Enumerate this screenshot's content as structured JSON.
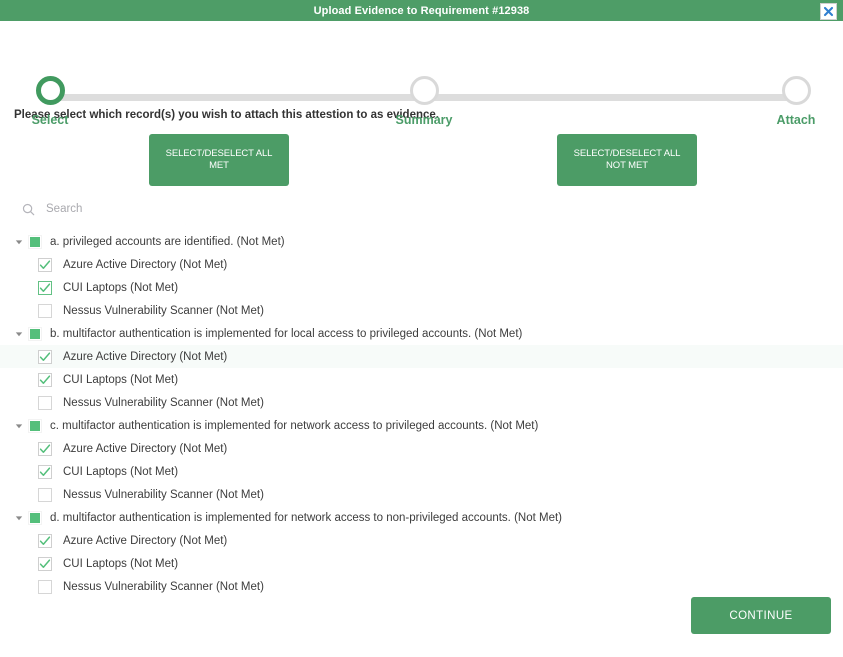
{
  "titlebar": {
    "title": "Upload Evidence to Requirement #12938",
    "close_icon": "close-icon",
    "background": "#4e9d67"
  },
  "stepper": {
    "steps": [
      {
        "label": "Select",
        "state": "active"
      },
      {
        "label": "Summary",
        "state": "inactive"
      },
      {
        "label": "Attach",
        "state": "inactive"
      }
    ],
    "active_color": "#419a5f",
    "inactive_color": "#d9d9d9",
    "label_color": "#4b9c68"
  },
  "instruction": "Please select which record(s) you wish to attach this attestion to as evidence.",
  "actions": {
    "select_all_met_line1": "SELECT/DESELECT ALL",
    "select_all_met_line2": "MET",
    "select_all_notmet_line1": "SELECT/DESELECT ALL",
    "select_all_notmet_line2": "NOT MET",
    "button_color": "#4c9c66"
  },
  "search": {
    "placeholder": "Search",
    "value": "",
    "icon": "search-icon"
  },
  "tree": {
    "groups": [
      {
        "label": "a. privileged accounts are identified. (Not Met)",
        "state": "indeterminate",
        "expanded": true,
        "children": [
          {
            "label": "Azure Active Directory (Not Met)",
            "state": "checked",
            "focused": false,
            "hover": false
          },
          {
            "label": "CUI Laptops (Not Met)",
            "state": "checked",
            "focused": true,
            "hover": false
          },
          {
            "label": "Nessus Vulnerability Scanner (Not Met)",
            "state": "unchecked",
            "focused": false,
            "hover": false
          }
        ]
      },
      {
        "label": "b. multifactor authentication is implemented for local access to privileged accounts. (Not Met)",
        "state": "indeterminate",
        "expanded": true,
        "children": [
          {
            "label": "Azure Active Directory (Not Met)",
            "state": "checked",
            "focused": false,
            "hover": true
          },
          {
            "label": "CUI Laptops (Not Met)",
            "state": "checked",
            "focused": false,
            "hover": false
          },
          {
            "label": "Nessus Vulnerability Scanner (Not Met)",
            "state": "unchecked",
            "focused": false,
            "hover": false
          }
        ]
      },
      {
        "label": "c. multifactor authentication is implemented for network access to privileged accounts. (Not Met)",
        "state": "indeterminate",
        "expanded": true,
        "children": [
          {
            "label": "Azure Active Directory (Not Met)",
            "state": "checked",
            "focused": false,
            "hover": false
          },
          {
            "label": "CUI Laptops (Not Met)",
            "state": "checked",
            "focused": false,
            "hover": false
          },
          {
            "label": "Nessus Vulnerability Scanner (Not Met)",
            "state": "unchecked",
            "focused": false,
            "hover": false
          }
        ]
      },
      {
        "label": "d. multifactor authentication is implemented for network access to non-privileged accounts. (Not Met)",
        "state": "indeterminate",
        "expanded": true,
        "children": [
          {
            "label": "Azure Active Directory (Not Met)",
            "state": "checked",
            "focused": false,
            "hover": false
          },
          {
            "label": "CUI Laptops (Not Met)",
            "state": "checked",
            "focused": false,
            "hover": false
          },
          {
            "label": "Nessus Vulnerability Scanner (Not Met)",
            "state": "unchecked",
            "focused": false,
            "hover": false
          }
        ]
      }
    ],
    "check_color": "#54bf7b"
  },
  "footer": {
    "continue_label": "CONTINUE"
  }
}
